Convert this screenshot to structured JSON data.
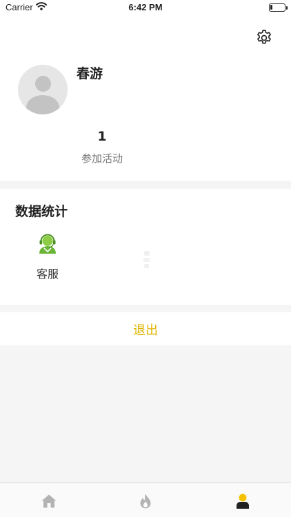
{
  "status_bar": {
    "carrier": "Carrier",
    "time": "6:42 PM",
    "battery_level": 0.15
  },
  "profile": {
    "username": "春游",
    "stats": [
      {
        "value": "1",
        "label": "参加活动"
      }
    ],
    "settings_icon": "gear-icon",
    "avatar_icon": "default-avatar"
  },
  "stats_section": {
    "title": "数据统计",
    "items": [
      {
        "label": "客服",
        "icon": "customer-service-icon"
      }
    ]
  },
  "logout": {
    "label": "退出"
  },
  "tab_bar": {
    "tabs": [
      {
        "icon": "home-icon",
        "active": false
      },
      {
        "icon": "flame-icon",
        "active": false
      },
      {
        "icon": "person-icon",
        "active": true
      }
    ]
  },
  "colors": {
    "accent": "#e0b400",
    "tab_inactive": "#b3b3b3",
    "tab_active_head": "#f5c000",
    "service_icon_green": "#6ab536",
    "page_background": "#f5f5f5"
  }
}
